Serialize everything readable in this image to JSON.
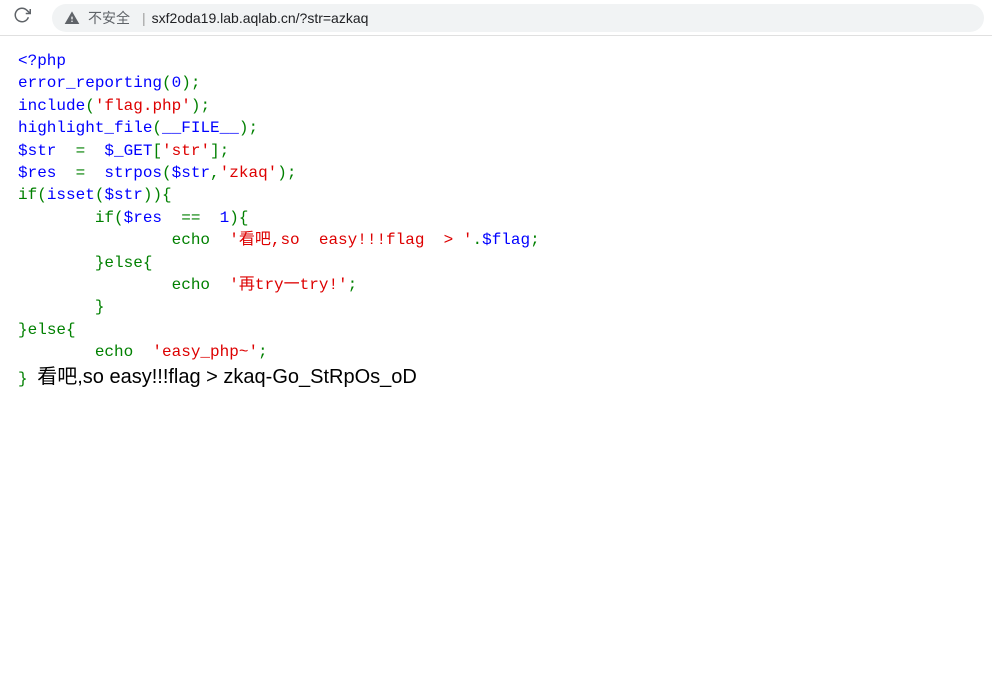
{
  "browser": {
    "security_label": "不安全",
    "url": "sxf2oda19.lab.aqlab.cn/?str=azkaq"
  },
  "code": {
    "open_tag": "<?php",
    "line1_func": "error_reporting",
    "line1_arg": "0",
    "line2_func": "include",
    "line2_str": "'flag.php'",
    "line3_func": "highlight_file",
    "line3_const": "__FILE__",
    "line4_var": "$str",
    "line4_get": "$_GET",
    "line4_key": "'str'",
    "line5_var": "$res",
    "line5_func": "strpos",
    "line5_arg1": "$str",
    "line5_arg2": "'zkaq'",
    "line6_if": "if",
    "line6_isset": "isset",
    "line6_var": "$str",
    "line7_if": "if",
    "line7_var": "$res",
    "line7_eq": "==",
    "line7_val": "1",
    "line8_echo": "echo",
    "line8_str": "'看吧,so  easy!!!flag  > '",
    "line8_dot": ".",
    "line8_var": "$flag",
    "line9_else": "else",
    "line10_echo": "echo",
    "line10_str": "'再try一try!'",
    "line12_else": "else",
    "line13_echo": "echo",
    "line13_str": "'easy_php~'",
    "close_brace": "}"
  },
  "output": {
    "text": "看吧,so easy!!!flag > zkaq-Go_StRpOs_oD"
  }
}
